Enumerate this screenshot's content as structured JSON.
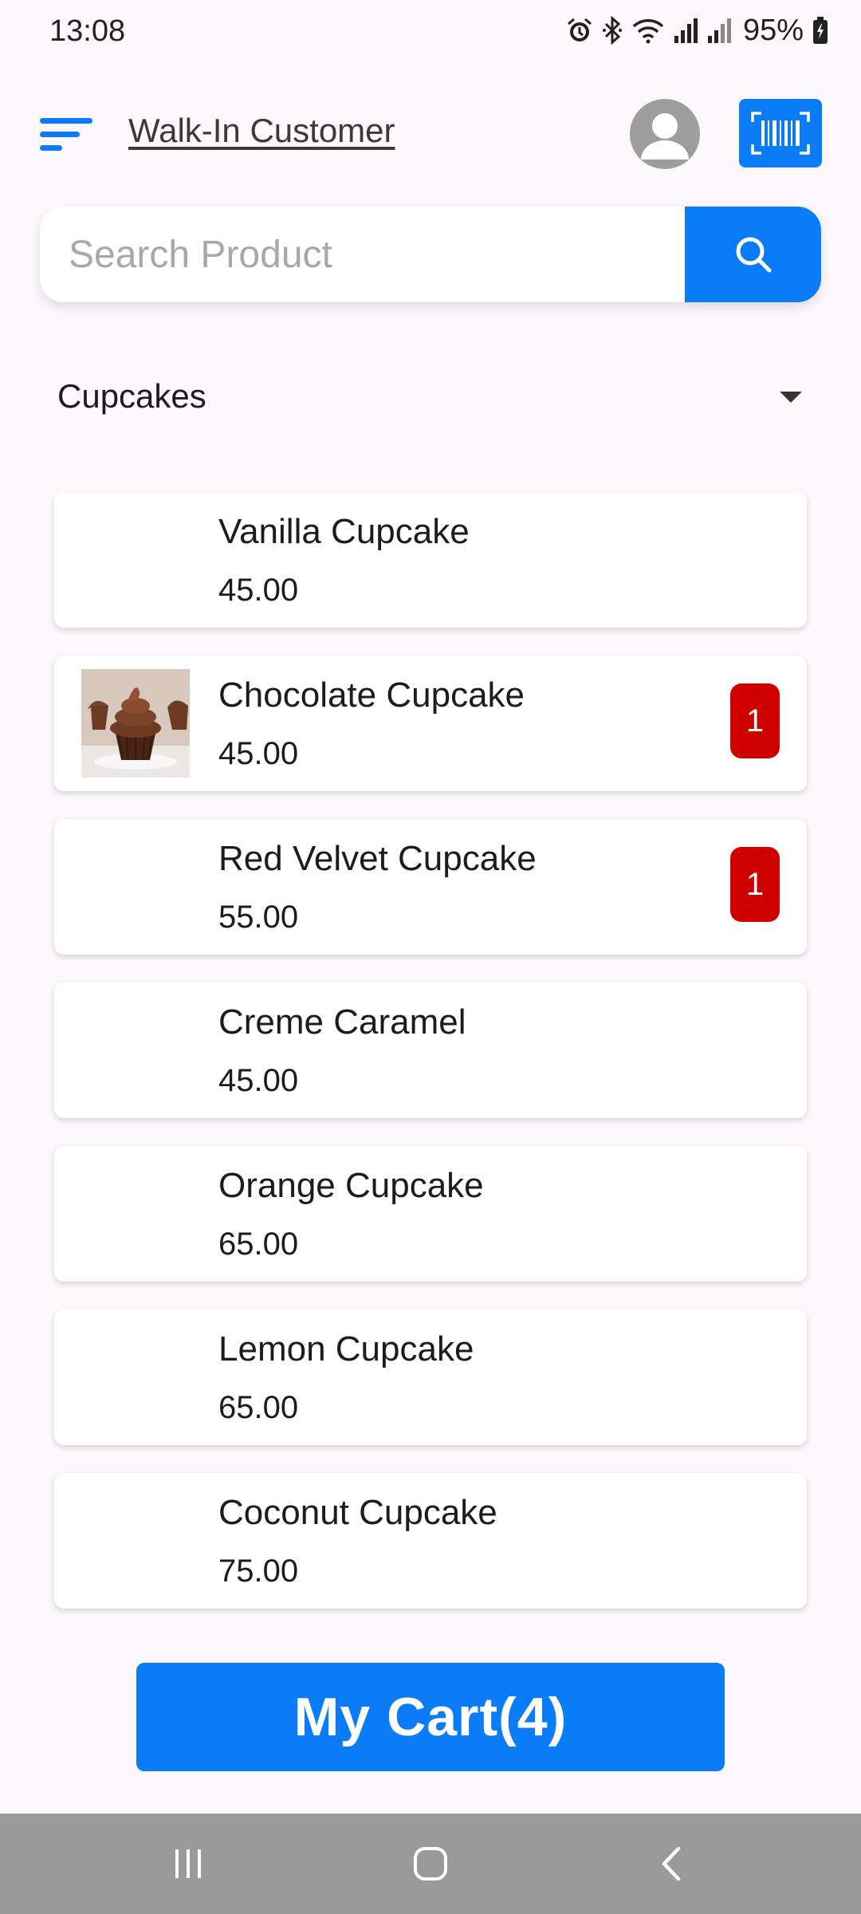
{
  "status_bar": {
    "time": "13:08",
    "battery": "95%",
    "icons": [
      "alarm-icon",
      "bluetooth-icon",
      "wifi-icon",
      "signal-icon",
      "signal-icon",
      "battery-icon"
    ]
  },
  "header": {
    "customer": "Walk-In Customer",
    "menu_icon": "menu-icon",
    "avatar_icon": "user-avatar-icon",
    "scan_icon": "barcode-scan-icon"
  },
  "search": {
    "placeholder": "Search Product",
    "value": "",
    "icon": "search-icon"
  },
  "category": {
    "selected": "Cupcakes"
  },
  "products": [
    {
      "name": "Vanilla Cupcake",
      "price": "45.00",
      "qty": "",
      "has_image": false
    },
    {
      "name": "Chocolate Cupcake",
      "price": "45.00",
      "qty": "1",
      "has_image": true
    },
    {
      "name": "Red Velvet Cupcake",
      "price": "55.00",
      "qty": "1",
      "has_image": false
    },
    {
      "name": "Creme Caramel",
      "price": "45.00",
      "qty": "",
      "has_image": false
    },
    {
      "name": "Orange Cupcake",
      "price": "65.00",
      "qty": "",
      "has_image": false
    },
    {
      "name": "Lemon Cupcake",
      "price": "65.00",
      "qty": "",
      "has_image": false
    },
    {
      "name": "Coconut Cupcake",
      "price": "75.00",
      "qty": "",
      "has_image": false
    }
  ],
  "cart": {
    "label": "My Cart(4)"
  },
  "colors": {
    "accent": "#0a7cf7",
    "badge": "#d00000",
    "background": "#fcf8fc"
  }
}
